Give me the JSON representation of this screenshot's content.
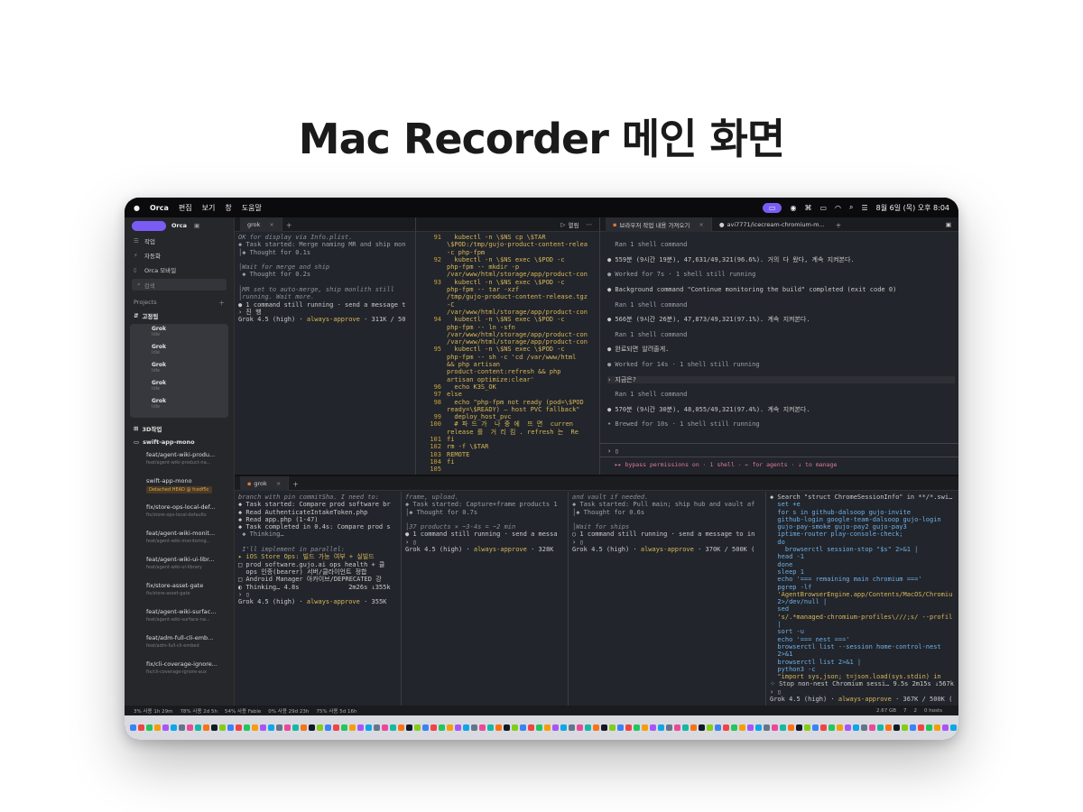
{
  "heading": "Mac Recorder 메인 화면",
  "menubar": {
    "app": "Orca",
    "menus": [
      "편집",
      "보기",
      "창",
      "도움말"
    ],
    "clock": "8월 6일 (목) 오후 8:04"
  },
  "sidebar": {
    "app_label": "Orca",
    "items": [
      "작업",
      "자동화",
      "Orca 모바일"
    ],
    "search_placeholder": "검색",
    "projects_label": "Projects",
    "pinned_label": "고정됨",
    "grok_items": [
      {
        "title": "Grok",
        "sub": "Idle"
      },
      {
        "title": "Grok",
        "sub": "Idle"
      },
      {
        "title": "Grok",
        "sub": "Idle"
      },
      {
        "title": "Grok",
        "sub": "Idle"
      },
      {
        "title": "Grok",
        "sub": "Idle"
      }
    ],
    "group_3d": "3D작업",
    "repo": "swift-app-mono",
    "branches": [
      {
        "title": "feat/agent-wiki-produ...",
        "sub": "feat/agent-wiki-product-na..."
      },
      {
        "title": "swift-app-mono",
        "tag": "Detached HEAD @ fcedf5c"
      },
      {
        "title": "fix/store-ops-local-def...",
        "sub": "fix/store-ops-local-defaults"
      },
      {
        "title": "feat/agent-wiki-monit...",
        "sub": "feat/agent-wiki-monitoring..."
      },
      {
        "title": "feat/agent-wiki-ui-libr...",
        "sub": "feat/agent-wiki-ui-library"
      },
      {
        "title": "fix/store-asset-gate",
        "sub": "fix/store-asset-gate"
      },
      {
        "title": "feat/agent-wiki-surfac...",
        "sub": "feat/agent-wiki-surface-na..."
      },
      {
        "title": "feat/adm-full-cli-emb...",
        "sub": "feat/adm-full-cli-embed"
      },
      {
        "title": "fix/cli-coverage-ignore...",
        "sub": "fix/cli-coverage-ignore-aux"
      }
    ]
  },
  "top_left_pane": {
    "tab": "grok",
    "lines": [
      {
        "t": "OK for display via Info.plist.",
        "c": "dim"
      },
      {
        "t": "◆ Task started: Merge naming MR and ship mon",
        "c": "gr"
      },
      {
        "t": "│◆ Thought for 0.1s",
        "c": "gr"
      },
      {
        "t": "",
        "c": ""
      },
      {
        "t": "│Wait for merge and ship",
        "c": "dim"
      },
      {
        "t": " ◆ Thought for 0.2s",
        "c": "gr"
      },
      {
        "t": "",
        "c": ""
      },
      {
        "t": "│MR set to auto-merge, ship monlith still",
        "c": "dim"
      },
      {
        "t": "│running. Wait more.",
        "c": "dim"
      },
      {
        "t": "● 1 command still running · send a message t",
        "c": ""
      },
      {
        "t": "› 진 행",
        "c": ""
      },
      {
        "t": "Grok 4.5 (high) · always-approve · 311K / 50",
        "c": "status"
      }
    ]
  },
  "code_pane": {
    "label": "열림",
    "lines": [
      {
        "n": "91",
        "t": "  kubectl -n \\$NS cp \\$TAR"
      },
      {
        "n": "",
        "t": "\\$POD:/tmp/gujo-product-content-relea"
      },
      {
        "n": "",
        "t": "-c php-fpm"
      },
      {
        "n": "92",
        "t": "  kubectl -n \\$NS exec \\$POD -c"
      },
      {
        "n": "",
        "t": "php-fpm -- mkdir -p"
      },
      {
        "n": "",
        "t": "/var/www/html/storage/app/product-con"
      },
      {
        "n": "93",
        "t": "  kubectl -n \\$NS exec \\$POD -c"
      },
      {
        "n": "",
        "t": "php-fpm -- tar -xzf"
      },
      {
        "n": "",
        "t": "/tmp/gujo-product-content-release.tgz"
      },
      {
        "n": "",
        "t": "-C"
      },
      {
        "n": "",
        "t": "/var/www/html/storage/app/product-con"
      },
      {
        "n": "94",
        "t": "  kubectl -n \\$NS exec \\$POD -c"
      },
      {
        "n": "",
        "t": "php-fpm -- ln -sfn"
      },
      {
        "n": "",
        "t": "/var/www/html/storage/app/product-con"
      },
      {
        "n": "",
        "t": "/var/www/html/storage/app/product-con"
      },
      {
        "n": "95",
        "t": "  kubectl -n \\$NS exec \\$POD -c"
      },
      {
        "n": "",
        "t": "php-fpm -- sh -c 'cd /var/www/html"
      },
      {
        "n": "",
        "t": "&& php artisan"
      },
      {
        "n": "",
        "t": "product-content:refresh && php"
      },
      {
        "n": "",
        "t": "artisan optimize:clear'"
      },
      {
        "n": "96",
        "t": "  echo K3S_OK"
      },
      {
        "n": "97",
        "t": "else"
      },
      {
        "n": "98",
        "t": "  echo \"php-fpm not ready (pod=\\$POD"
      },
      {
        "n": "",
        "t": "ready=\\$READY) — host PVC fallback\""
      },
      {
        "n": "99",
        "t": "  deploy_host_pvc"
      },
      {
        "n": "100",
        "t": "  # 파 드 가  나 중 에  뜨 면  curren"
      },
      {
        "n": "",
        "t": "release 를  거 리 킴 . refresh 는  Re"
      },
      {
        "n": "101",
        "t": "fi"
      },
      {
        "n": "102",
        "t": "rm -f \\$TAR"
      },
      {
        "n": "103",
        "t": "REMOTE"
      },
      {
        "n": "104",
        "t": "fi"
      },
      {
        "n": "105",
        "t": ""
      }
    ]
  },
  "right_pane": {
    "tabs": [
      "브라우저 작업 내용 가져오기",
      "avi7771/icecream-chromium-m..."
    ],
    "lines": [
      {
        "t": "",
        "c": ""
      },
      {
        "t": "  Ran 1 shell command",
        "c": "gr"
      },
      {
        "t": "",
        "c": ""
      },
      {
        "t": "● 559분 (9시간 19분), 47,631/49,321(96.6%). 거의 다 왔다, 계속 지켜본다.",
        "c": ""
      },
      {
        "t": "",
        "c": ""
      },
      {
        "t": "● Worked for 7s · 1 shell still running",
        "c": "gr"
      },
      {
        "t": "",
        "c": ""
      },
      {
        "t": "● Background command \"Continue monitoring the build\" completed (exit code 0)",
        "c": ""
      },
      {
        "t": "",
        "c": ""
      },
      {
        "t": "  Ran 1 shell command",
        "c": "gr"
      },
      {
        "t": "",
        "c": ""
      },
      {
        "t": "● 566분 (9시간 26분), 47,873/49,321(97.1%). 계속 지켜본다.",
        "c": ""
      },
      {
        "t": "",
        "c": ""
      },
      {
        "t": "  Ran 1 shell command",
        "c": "gr"
      },
      {
        "t": "",
        "c": ""
      },
      {
        "t": "● 완료되면 알려줄게.",
        "c": ""
      },
      {
        "t": "",
        "c": ""
      },
      {
        "t": "● Worked for 14s · 1 shell still running",
        "c": "gr"
      },
      {
        "t": "",
        "c": ""
      },
      {
        "t": "› 지금은?",
        "c": "prompt"
      },
      {
        "t": "",
        "c": ""
      },
      {
        "t": "  Ran 1 shell command",
        "c": "gr"
      },
      {
        "t": "",
        "c": ""
      },
      {
        "t": "● 570분 (9시간 30분), 48,055/49,321(97.4%). 계속 지켜본다.",
        "c": ""
      },
      {
        "t": "",
        "c": ""
      },
      {
        "t": "• Brewed for 10s · 1 shell still running",
        "c": "gr"
      }
    ],
    "input_prompt": "› ▯",
    "footer": "  ▸▸ bypass permissions on · 1 shell · ← for agents · ↓ to manage"
  },
  "bottom": {
    "tab": "grok",
    "col1": [
      {
        "t": "branch with pin commitSha. I need to:",
        "c": "dim"
      },
      {
        "t": "◆ Task started: Compare prod software br",
        "c": ""
      },
      {
        "t": "◆ Read AuthenticateIntakeToken.php",
        "c": ""
      },
      {
        "t": "◆ Read app.php (1-47)",
        "c": ""
      },
      {
        "t": "◆ Task completed in 0.4s: Compare prod s",
        "c": ""
      },
      {
        "t": " ◆ Thinking…",
        "c": "gr"
      },
      {
        "t": "",
        "c": ""
      },
      {
        "t": " I'll implement in parallel:",
        "c": "dim"
      },
      {
        "t": "▸ iOS Store Ops: 빌드 가능 여부 + 실빌드",
        "c": "yl"
      },
      {
        "t": "□ prod software.gujo.ai ops health + 클",
        "c": ""
      },
      {
        "t": "  ops 인증(bearer) 서버/클라이언트 정합",
        "c": ""
      },
      {
        "t": "□ Android Manager 아카이브/DEPRECATED 강",
        "c": ""
      },
      {
        "t": "◐ Thinking… 4.8s             2m26s ↓355k",
        "c": ""
      },
      {
        "t": "› ▯",
        "c": ""
      },
      {
        "t": "Grok 4.5 (high) · always-approve · 355K",
        "c": "status"
      }
    ],
    "col2": [
      {
        "t": "frame, upload.",
        "c": "dim"
      },
      {
        "t": "◆ Task started: Capture+frame products 1",
        "c": "gr"
      },
      {
        "t": "│◆ Thought for 0.7s",
        "c": "gr"
      },
      {
        "t": "",
        "c": ""
      },
      {
        "t": "│37 products × ~3-4s = ~2 min",
        "c": "dim"
      },
      {
        "t": "● 1 command still running · send a messa",
        "c": ""
      },
      {
        "t": "› ▯",
        "c": ""
      },
      {
        "t": "Grok 4.5 (high) · always-approve · 328K",
        "c": "status"
      }
    ],
    "col3": [
      {
        "t": "and vault if needed.",
        "c": "dim"
      },
      {
        "t": "◆ Task started: Pull main; ship hub and vault af",
        "c": "gr"
      },
      {
        "t": "│◆ Thought for 0.6s",
        "c": "gr"
      },
      {
        "t": "",
        "c": ""
      },
      {
        "t": "│Wait for ships",
        "c": "dim"
      },
      {
        "t": "○ 1 command still running · send a message to in",
        "c": ""
      },
      {
        "t": "› ▯",
        "c": ""
      },
      {
        "t": "Grok 4.5 (high) · always-approve · 370K / 500K (",
        "c": "status"
      }
    ],
    "col4": [
      {
        "t": "◆ Search \"struct ChromeSessionInfo\" in **/*.swi…",
        "c": ""
      },
      {
        "t": "  set +e",
        "c": "bl"
      },
      {
        "t": "  for s in github-dalsoop gujo-invite",
        "c": "bl"
      },
      {
        "t": "  github-login google-team-dalsoop gujo-login",
        "c": "bl"
      },
      {
        "t": "  gujo-pay-smoke gujo-pay2 gujo-pay3",
        "c": "bl"
      },
      {
        "t": "  iptime-router play-console-check;",
        "c": "bl"
      },
      {
        "t": "  do",
        "c": "bl"
      },
      {
        "t": "    browserctl session-stop \"$s\" 2>&1 |",
        "c": "bl"
      },
      {
        "t": "  head -1",
        "c": "bl"
      },
      {
        "t": "  done",
        "c": "bl"
      },
      {
        "t": "  sleep 1",
        "c": "bl"
      },
      {
        "t": "  echo '=== remaining main chromium ==='",
        "c": "bl"
      },
      {
        "t": "  pgrep -lf",
        "c": "bl"
      },
      {
        "t": "  'AgentBrowserEngine.app/Contents/MacOS/Chromiu",
        "c": "yl"
      },
      {
        "t": "  2>/dev/null |",
        "c": "bl"
      },
      {
        "t": "  sed",
        "c": "bl"
      },
      {
        "t": "  's/.*managed-chromium-profiles\\///;s/ --profil",
        "c": "yl"
      },
      {
        "t": "  |",
        "c": "bl"
      },
      {
        "t": "  sort -u",
        "c": "bl"
      },
      {
        "t": "  echo '=== nest ==='",
        "c": "bl"
      },
      {
        "t": "  browserctl list --session home-control-nest",
        "c": "bl"
      },
      {
        "t": "  2>&1",
        "c": "bl"
      },
      {
        "t": "  browserctl list 2>&1 |",
        "c": "bl"
      },
      {
        "t": "  python3 -c",
        "c": "bl"
      },
      {
        "t": "  \"import sys,json; t=json.load(sys.stdin) in",
        "c": "yl"
      },
      {
        "t": "⁘ Stop non-nest Chromium sessi… 9.5s 2m15s ↓567k",
        "c": ""
      },
      {
        "t": "› ▯",
        "c": ""
      },
      {
        "t": "Grok 4.5 (high) · always-approve · 367K / 500K (",
        "c": "status"
      }
    ]
  },
  "statusbar": [
    "3% 사용 1h 29m",
    "78% 사용 2d 5h",
    "54% 사용 Fable",
    "0% 사용 29d 23h",
    "75% 사용 5d 16h",
    "2.67 GB",
    "7",
    "2",
    "0 hosts"
  ]
}
